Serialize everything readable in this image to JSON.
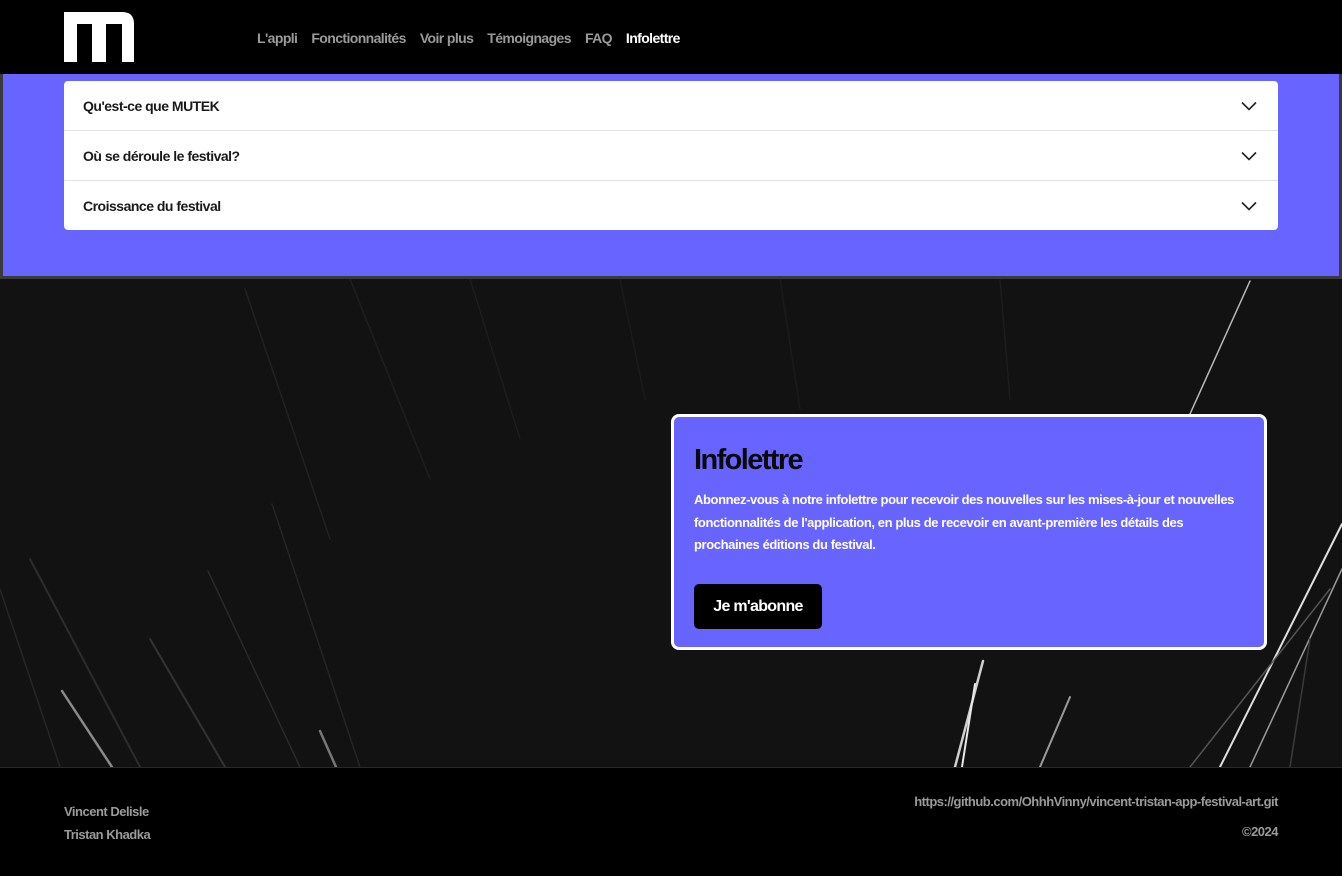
{
  "header": {
    "logo_icon": "mutek-logo-icon",
    "nav": [
      {
        "label": "L'appli",
        "active": false
      },
      {
        "label": "Fonctionnalités",
        "active": false
      },
      {
        "label": "Voir plus",
        "active": false
      },
      {
        "label": "Témoignages",
        "active": false
      },
      {
        "label": "FAQ",
        "active": false
      },
      {
        "label": "Infolettre",
        "active": true
      }
    ]
  },
  "faq": {
    "items": [
      {
        "question": "Qu'est-ce que MUTEK",
        "icon": "chevron-down-icon"
      },
      {
        "question": "Où se déroule le festival?",
        "icon": "chevron-down-icon"
      },
      {
        "question": "Croissance du festival",
        "icon": "chevron-down-icon"
      }
    ]
  },
  "newsletter": {
    "title": "Infolettre",
    "text": "Abonnez-vous à notre infolettre pour recevoir des nouvelles sur les mises-à-jour et nouvelles fonctionnalités de l'application, en plus de recevoir en avant-première les détails des prochaines éditions du festival.",
    "button_label": "Je m'abonne"
  },
  "footer": {
    "authors": [
      "Vincent Delisle",
      "Tristan Khadka"
    ],
    "repo_link": "https://github.com/OhhhVinny/vincent-tristan-app-festival-art.git",
    "copyright": "©2024"
  },
  "colors": {
    "accent": "#6864ff",
    "background": "#000000",
    "section_dark": "#121212"
  }
}
